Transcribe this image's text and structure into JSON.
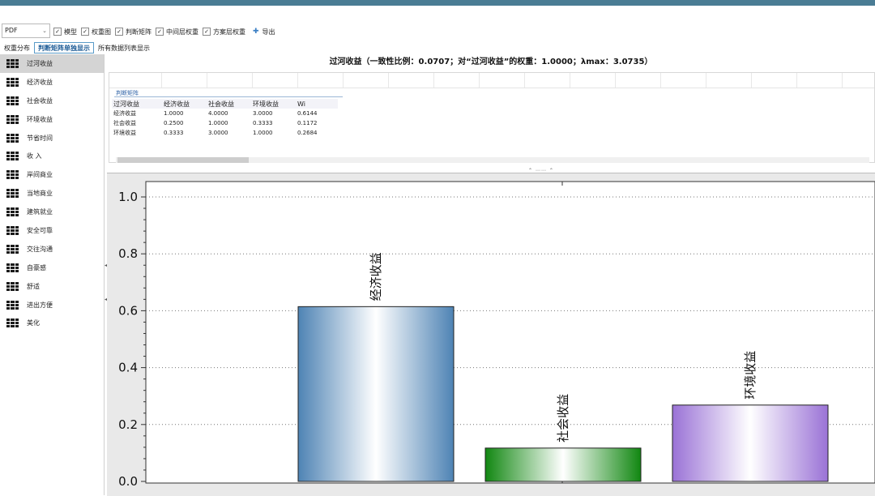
{
  "toolbar": {
    "format": "PDF",
    "checkboxes": [
      {
        "label": "模型",
        "checked": true
      },
      {
        "label": "权重图",
        "checked": true
      },
      {
        "label": "判断矩阵",
        "checked": true
      },
      {
        "label": "中间层权重",
        "checked": true
      },
      {
        "label": "方案层权重",
        "checked": true
      }
    ],
    "export_label": "导出"
  },
  "tabs": [
    {
      "label": "权重分布",
      "active": false
    },
    {
      "label": "判断矩阵单独显示",
      "active": true
    },
    {
      "label": "所有数据列表显示",
      "active": false
    }
  ],
  "sidebar": {
    "items": [
      {
        "label": "过河收益",
        "active": true
      },
      {
        "label": "经济收益",
        "active": false
      },
      {
        "label": "社会收益",
        "active": false
      },
      {
        "label": "环境收益",
        "active": false
      },
      {
        "label": "节省时间",
        "active": false
      },
      {
        "label": "收 入",
        "active": false
      },
      {
        "label": "岸间商业",
        "active": false
      },
      {
        "label": "当地商业",
        "active": false
      },
      {
        "label": "建筑就业",
        "active": false
      },
      {
        "label": "安全可靠",
        "active": false
      },
      {
        "label": "交往沟通",
        "active": false
      },
      {
        "label": "自豪感",
        "active": false
      },
      {
        "label": "舒适",
        "active": false
      },
      {
        "label": "进出方便",
        "active": false
      },
      {
        "label": "美化",
        "active": false
      }
    ]
  },
  "panel_title": "过河收益（一致性比例：0.0707；对“过河收益”的权重：1.0000；λmax：3.0735）",
  "matrix": {
    "section_label": "判断矩阵",
    "headers": [
      "过河收益",
      "经济收益",
      "社会收益",
      "环境收益",
      "Wi"
    ],
    "rows": [
      [
        "经济收益",
        "1.0000",
        "4.0000",
        "3.0000",
        "0.6144"
      ],
      [
        "社会收益",
        "0.2500",
        "1.0000",
        "0.3333",
        "0.1172"
      ],
      [
        "环境收益",
        "0.3333",
        "3.0000",
        "1.0000",
        "0.2684"
      ]
    ]
  },
  "chart_data": {
    "type": "bar",
    "categories": [
      "经济收益",
      "社会收益",
      "环境收益"
    ],
    "values": [
      0.6144,
      0.1172,
      0.2684
    ],
    "ylim": [
      0,
      1.0
    ],
    "yticks": [
      "0.0",
      "0.2",
      "0.4",
      "0.6",
      "0.8",
      "1.0"
    ],
    "grid": true,
    "colors": [
      [
        "#4e83b4",
        "#ffffff"
      ],
      [
        "#118711",
        "#ffffff"
      ],
      [
        "#9a72d6",
        "#ffffff"
      ]
    ]
  }
}
